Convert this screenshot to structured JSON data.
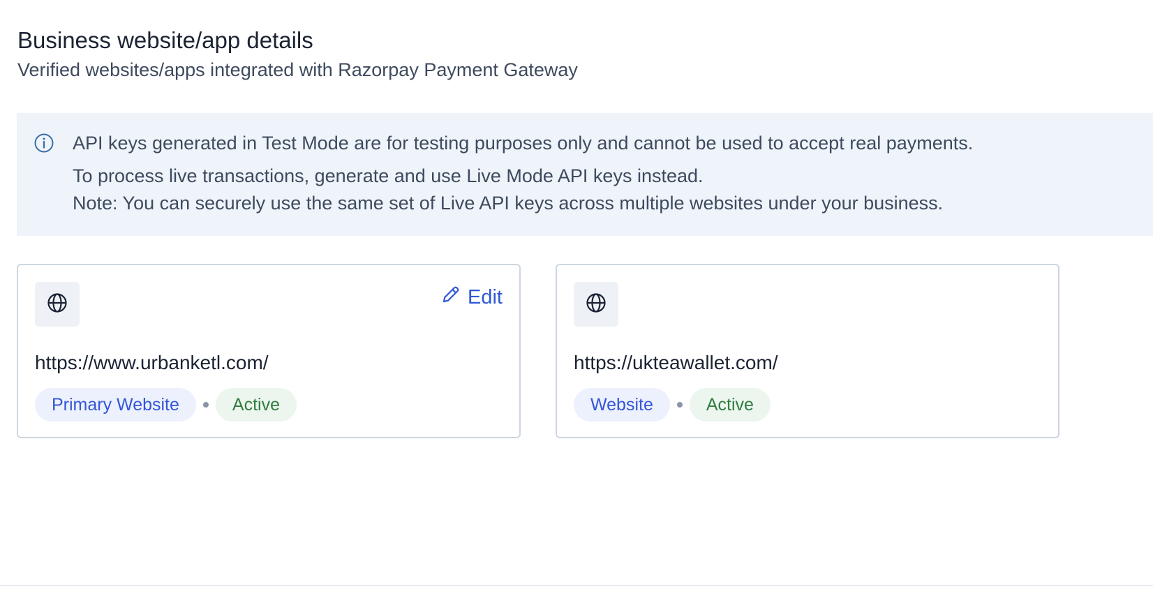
{
  "header": {
    "title": "Business website/app details",
    "subtitle": "Verified websites/apps integrated with Razorpay Payment Gateway"
  },
  "banner": {
    "icon": "info-icon",
    "line1": "API keys generated in Test Mode are for testing purposes only and cannot be used to accept real payments.",
    "line2": "To process live transactions, generate and use Live Mode API keys instead.",
    "line3": "Note: You can securely use the same set of Live API keys across multiple websites under your business."
  },
  "cards": [
    {
      "icon": "globe-icon",
      "url": "https://www.urbanketl.com/",
      "type_label": "Primary Website",
      "status_label": "Active",
      "edit_label": "Edit",
      "edit_icon": "pencil-icon"
    },
    {
      "icon": "globe-icon",
      "url": "https://ukteawallet.com/",
      "type_label": "Website",
      "status_label": "Active"
    }
  ],
  "colors": {
    "accent": "#2e57d6",
    "banner_bg": "#eef4fa",
    "type_badge_bg": "#edf1fd",
    "status_badge_bg": "#ecf6ee",
    "status_text": "#2f7d3f"
  }
}
